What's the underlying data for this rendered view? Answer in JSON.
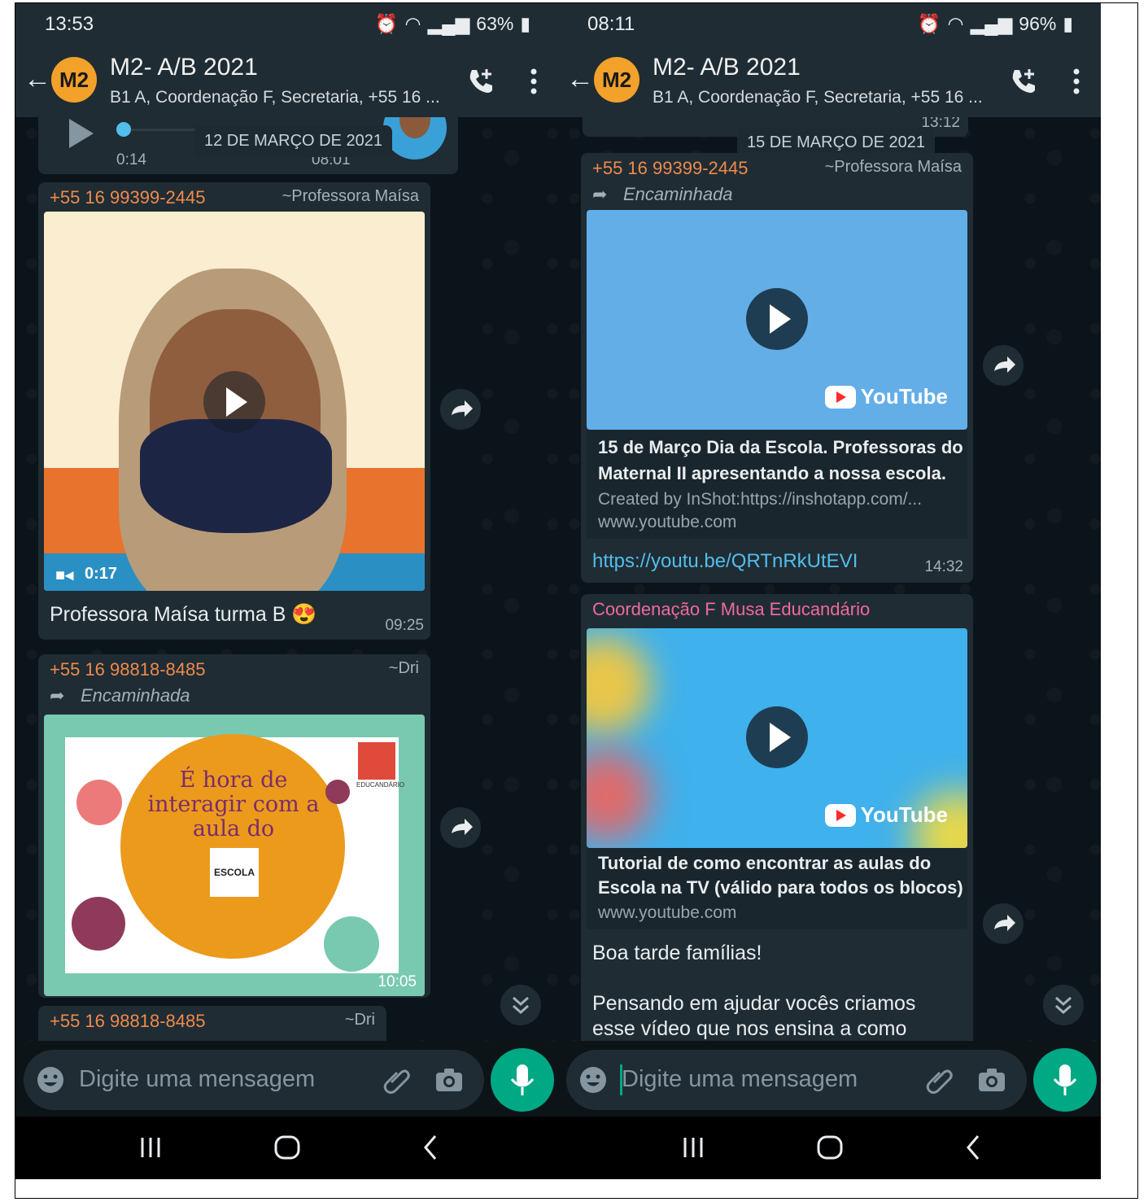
{
  "left": {
    "status": {
      "time": "13:53",
      "battery": "63%"
    },
    "header": {
      "avatar": "M2",
      "title": "M2- A/B 2021",
      "subtitle": "B1 A, Coordenação F, Secretaria, +55 16 ..."
    },
    "audio": {
      "duration": "0:14",
      "time": "08:01"
    },
    "date_chip": "12 DE MARÇO DE 2021",
    "msg1": {
      "sender": "+55 16 99399-2445",
      "alias": "~Professora Maísa",
      "video_duration": "0:17",
      "caption": "Professora Maísa turma B 😍",
      "time": "09:25"
    },
    "msg2": {
      "sender": "+55 16 98818-8485",
      "alias": "~Dri",
      "forwarded": "Encaminhada",
      "time": "10:05",
      "image_text": "É hora de interagir com a aula do",
      "image_logo": "ESCOLA",
      "image_brand": "EDUCANDÁRIO"
    },
    "msg3": {
      "sender": "+55 16 98818-8485",
      "alias": "~Dri"
    },
    "input": {
      "placeholder": "Digite uma mensagem"
    }
  },
  "right": {
    "status": {
      "time": "08:11",
      "battery": "96%"
    },
    "header": {
      "avatar": "M2",
      "title": "M2- A/B 2021",
      "subtitle": "B1 A, Coordenação F, Secretaria, +55 16 ..."
    },
    "top_time": "13:12",
    "date_chip": "15 DE MARÇO DE 2021",
    "msg1": {
      "sender": "+55 16 99399-2445",
      "alias": "~Professora Maísa",
      "forwarded": "Encaminhada",
      "youtube": "YouTube",
      "link_title": "15 de Março Dia da Escola. Professoras do Maternal II apresentando a nossa escola.",
      "link_desc": "Created by InShot:https://inshotapp.com/...",
      "link_domain": "www.youtube.com",
      "url": "https://youtu.be/QRTnRkUtEVI",
      "time": "14:32"
    },
    "msg2": {
      "sender": "Coordenação F Musa Educandário",
      "youtube": "YouTube",
      "link_title": "Tutorial de como encontrar as aulas do Escola na TV (válido para todos os blocos)",
      "link_domain": "www.youtube.com",
      "line1": "Boa tarde famílias!",
      "line2": "Pensando em ajudar vocês criamos esse vídeo que nos ensina a como"
    },
    "input": {
      "placeholder": "Digite uma mensagem"
    }
  },
  "colors": {
    "accent": "#00a884",
    "sender": "#f08a4b",
    "sender_pink": "#f06a9b",
    "link": "#53bdeb"
  }
}
